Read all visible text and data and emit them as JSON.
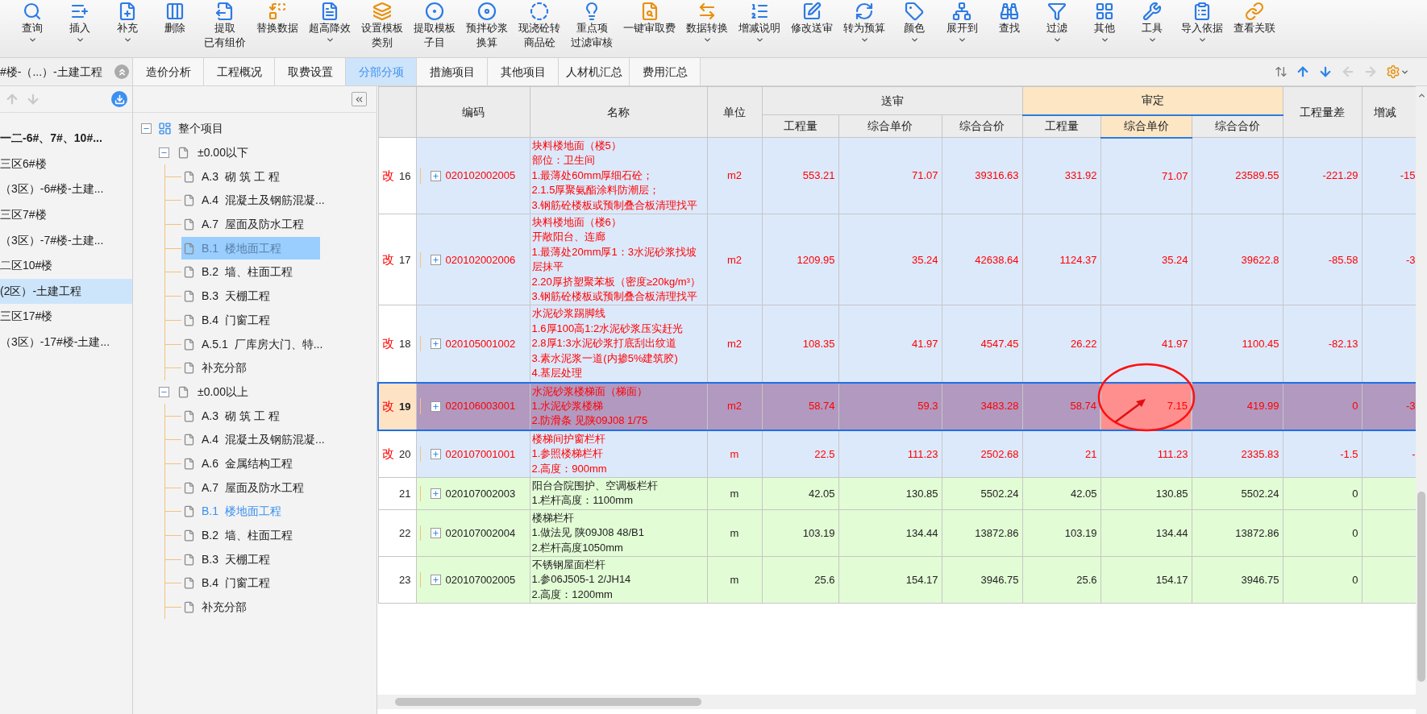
{
  "toolbar": [
    {
      "label": [
        "查询"
      ],
      "dropdown": true
    },
    {
      "label": [
        "插入"
      ],
      "dropdown": true
    },
    {
      "label": [
        "补充"
      ],
      "dropdown": true
    },
    {
      "label": [
        "删除"
      ],
      "dropdown": false
    },
    {
      "label": [
        "提取",
        "已有组价"
      ],
      "dropdown": false
    },
    {
      "label": [
        "替换数据"
      ],
      "dropdown": false
    },
    {
      "label": [
        "超高降效"
      ],
      "dropdown": true
    },
    {
      "label": [
        "设置模板",
        "类别"
      ],
      "dropdown": false
    },
    {
      "label": [
        "提取模板",
        "子目"
      ],
      "dropdown": false
    },
    {
      "label": [
        "预拌砂浆",
        "换算"
      ],
      "dropdown": false
    },
    {
      "label": [
        "现浇砼转",
        "商品砼"
      ],
      "dropdown": false
    },
    {
      "label": [
        "重点项",
        "过滤审核"
      ],
      "dropdown": false
    },
    {
      "label": [
        "一键审取费"
      ],
      "dropdown": false
    },
    {
      "label": [
        "数据转换"
      ],
      "dropdown": true
    },
    {
      "label": [
        "增减说明"
      ],
      "dropdown": true
    },
    {
      "label": [
        "修改送审"
      ],
      "dropdown": false
    },
    {
      "label": [
        "转为预算"
      ],
      "dropdown": true
    },
    {
      "label": [
        "颜色"
      ],
      "dropdown": true
    },
    {
      "label": [
        "展开到"
      ],
      "dropdown": true
    },
    {
      "label": [
        "查找"
      ],
      "dropdown": false
    },
    {
      "label": [
        "过滤"
      ],
      "dropdown": true
    },
    {
      "label": [
        "其他"
      ],
      "dropdown": true
    },
    {
      "label": [
        "工具"
      ],
      "dropdown": true
    },
    {
      "label": [
        "导入依据"
      ],
      "dropdown": true
    },
    {
      "label": [
        "查看关联"
      ],
      "dropdown": false
    }
  ],
  "project_panel": {
    "title": "#楼-（...）-土建工程",
    "items": [
      {
        "label": "一二-6#、7#、10#...",
        "bold": true,
        "selected": false
      },
      {
        "label": "三区6#楼",
        "bold": false,
        "selected": false
      },
      {
        "label": "（3区）-6#楼-土建...",
        "bold": false,
        "selected": false
      },
      {
        "label": "三区7#楼",
        "bold": false,
        "selected": false
      },
      {
        "label": "（3区）-7#楼-土建...",
        "bold": false,
        "selected": false
      },
      {
        "label": "二区10#楼",
        "bold": false,
        "selected": false
      },
      {
        "label": "(2区）-土建工程",
        "bold": false,
        "selected": true
      },
      {
        "label": "三区17#楼",
        "bold": false,
        "selected": false
      },
      {
        "label": "（3区）-17#楼-土建...",
        "bold": false,
        "selected": false
      }
    ]
  },
  "tabs": [
    {
      "label": "造价分析",
      "selected": false
    },
    {
      "label": "工程概况",
      "selected": false
    },
    {
      "label": "取费设置",
      "selected": false
    },
    {
      "label": "分部分项",
      "selected": true
    },
    {
      "label": "措施项目",
      "selected": false
    },
    {
      "label": "其他项目",
      "selected": false
    },
    {
      "label": "人材机汇总",
      "selected": false
    },
    {
      "label": "费用汇总",
      "selected": false
    }
  ],
  "tree": {
    "label": "整个项目",
    "expanded": true,
    "children": [
      {
        "label": "±0.00以下",
        "expanded": true,
        "children": [
          {
            "code": "A.3",
            "label": "砌 筑 工 程",
            "selected": false,
            "current": false
          },
          {
            "code": "A.4",
            "label": "混凝土及钢筋混凝...",
            "selected": false,
            "current": false
          },
          {
            "code": "A.7",
            "label": "屋面及防水工程",
            "selected": false,
            "current": false
          },
          {
            "code": "B.1",
            "label": "楼地面工程",
            "selected": true,
            "current": false
          },
          {
            "code": "B.2",
            "label": "墙、柱面工程",
            "selected": false,
            "current": false
          },
          {
            "code": "B.3",
            "label": "天棚工程",
            "selected": false,
            "current": false
          },
          {
            "code": "B.4",
            "label": "门窗工程",
            "selected": false,
            "current": false
          },
          {
            "code": "A.5.1",
            "label": "厂库房大门、特...",
            "selected": false,
            "current": false
          },
          {
            "label": "补充分部",
            "selected": false,
            "current": false
          }
        ]
      },
      {
        "label": "±0.00以上",
        "expanded": true,
        "children": [
          {
            "code": "A.3",
            "label": "砌 筑 工 程",
            "selected": false,
            "current": false
          },
          {
            "code": "A.4",
            "label": "混凝土及钢筋混凝...",
            "selected": false,
            "current": false
          },
          {
            "code": "A.6",
            "label": "金属结构工程",
            "selected": false,
            "current": false
          },
          {
            "code": "A.7",
            "label": "屋面及防水工程",
            "selected": false,
            "current": false
          },
          {
            "code": "B.1",
            "label": "楼地面工程",
            "selected": false,
            "current": true
          },
          {
            "code": "B.2",
            "label": "墙、柱面工程",
            "selected": false,
            "current": false
          },
          {
            "code": "B.3",
            "label": "天棚工程",
            "selected": false,
            "current": false
          },
          {
            "code": "B.4",
            "label": "门窗工程",
            "selected": false,
            "current": false
          },
          {
            "label": "补充分部",
            "selected": false,
            "current": false
          }
        ]
      }
    ]
  },
  "table": {
    "header": {
      "code": "编码",
      "name": "名称",
      "unit": "单位",
      "groups": [
        {
          "label": "送审",
          "selected": false,
          "columns": [
            {
              "label": "工程量",
              "selected": false
            },
            {
              "label": "综合单价",
              "selected": false
            },
            {
              "label": "综合合价",
              "selected": false
            }
          ]
        },
        {
          "label": "审定",
          "selected": true,
          "columns": [
            {
              "label": "工程量",
              "selected": false
            },
            {
              "label": "综合单价",
              "selected": true
            },
            {
              "label": "综合合价",
              "selected": false
            }
          ]
        }
      ],
      "quantity_difference": "工程量差",
      "column_12": "增减"
    },
    "rows": [
      {
        "flag": "改",
        "number": "16",
        "modified": true,
        "selected": false,
        "flagged": false,
        "code": "020102002005",
        "name": [
          "块料楼地面（楼5）",
          "部位：卫生间",
          "1.最薄处60mm厚细石砼；",
          "2.1.5厚聚氨酯涂料防潮层；",
          "3.钢筋砼楼板或预制叠合板清理找平"
        ],
        "unit": "m2",
        "values": [
          "553.21",
          "71.07",
          "39316.63",
          "331.92",
          "71.07",
          "23589.55",
          "-221.29"
        ],
        "column_12": "-15"
      },
      {
        "flag": "改",
        "number": "17",
        "modified": true,
        "selected": false,
        "flagged": false,
        "code": "020102002006",
        "name": [
          "块料楼地面（楼6）",
          "开敞阳台、连廊",
          "1.最薄处20mm厚1：3水泥砂浆找坡层抹平",
          "2.20厚挤塑聚苯板（密度≥20kg/m³）",
          "3.钢筋砼楼板或预制叠合板清理找平"
        ],
        "unit": "m2",
        "values": [
          "1209.95",
          "35.24",
          "42638.64",
          "1124.37",
          "35.24",
          "39622.8",
          "-85.58"
        ],
        "column_12": "-3"
      },
      {
        "flag": "改",
        "number": "18",
        "modified": true,
        "selected": false,
        "flagged": false,
        "code": "020105001002",
        "name": [
          "水泥砂浆踢脚线",
          "1.6厚100高1:2水泥砂浆压实赶光",
          "2.8厚1:3水泥砂浆打底刮出纹道",
          "3.素水泥浆一道(内掺5%建筑胶)",
          "4.基层处理"
        ],
        "unit": "m2",
        "values": [
          "108.35",
          "41.97",
          "4547.45",
          "26.22",
          "41.97",
          "1100.45",
          "-82.13"
        ]
      },
      {
        "flag": "改",
        "number": "19",
        "modified": true,
        "selected": true,
        "flagged": true,
        "code": "020106003001",
        "name": [
          "水泥砂浆楼梯面（梯面）",
          "1.水泥砂浆楼梯",
          "2.防滑条 见陕09J08 1/75"
        ],
        "unit": "m2",
        "values": [
          "58.74",
          "59.3",
          "3483.28",
          "58.74",
          "7.15",
          "419.99",
          "0"
        ],
        "column_12": "-3"
      },
      {
        "flag": "改",
        "number": "20",
        "modified": true,
        "selected": false,
        "flagged": false,
        "code": "020107001001",
        "name": [
          "楼梯间护窗栏杆",
          "1.参照楼梯栏杆",
          "2.高度：900mm"
        ],
        "unit": "m",
        "values": [
          "22.5",
          "111.23",
          "2502.68",
          "21",
          "111.23",
          "2335.83",
          "-1.5"
        ],
        "column_12": "-"
      },
      {
        "number": "21",
        "modified": false,
        "selected": false,
        "flagged": false,
        "code": "020107002003",
        "name": [
          "阳台合院围护、空调板栏杆",
          "1.栏杆高度：1100mm"
        ],
        "unit": "m",
        "values": [
          "42.05",
          "130.85",
          "5502.24",
          "42.05",
          "130.85",
          "5502.24",
          "0"
        ]
      },
      {
        "number": "22",
        "modified": false,
        "selected": false,
        "flagged": false,
        "code": "020107002004",
        "name": [
          "楼梯栏杆",
          "1.做法见 陕09J08 48/B1",
          "2.栏杆高度1050mm"
        ],
        "unit": "m",
        "values": [
          "103.19",
          "134.44",
          "13872.86",
          "103.19",
          "134.44",
          "13872.86",
          "0"
        ]
      },
      {
        "number": "23",
        "modified": false,
        "selected": false,
        "flagged": false,
        "code": "020107002005",
        "name": [
          "不锈钢屋面栏杆",
          "1.参06J505-1 2/JH14",
          "2.高度：1200mm"
        ],
        "unit": "m",
        "values": [
          "25.6",
          "154.17",
          "3946.75",
          "25.6",
          "154.17",
          "3946.75",
          "0"
        ]
      }
    ]
  }
}
